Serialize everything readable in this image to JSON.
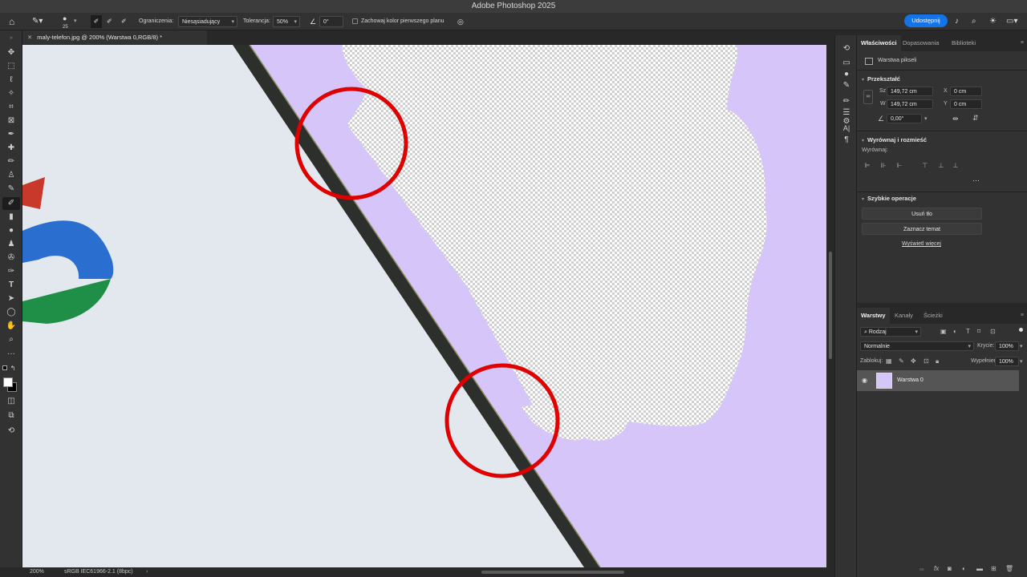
{
  "app": {
    "title": "Adobe Photoshop 2025"
  },
  "options": {
    "brush_size": "25",
    "constraints_label": "Ograniczenia:",
    "constraints_value": "Niesąsiadujący",
    "tolerance_label": "Tolerancja:",
    "tolerance_value": "50%",
    "angle_value": "0°",
    "protect_fg_label": "Zachowaj kolor pierwszego planu",
    "share_label": "Udostępnij"
  },
  "document": {
    "tab_title": "maly-telefon.jpg @ 200% (Warstwa 0,RGB/8) *"
  },
  "status": {
    "zoom": "200%",
    "profile": "sRGB IEC61966-2.1 (8bpc)"
  },
  "properties": {
    "tabs": [
      "Właściwości",
      "Dopasowania",
      "Biblioteki"
    ],
    "layer_kind": "Warstwa pikseli",
    "transform_title": "Przekształć",
    "w_label": "Sz",
    "w_value": "149,72 cm",
    "h_label": "W",
    "h_value": "149,72 cm",
    "x_label": "X",
    "x_value": "0 cm",
    "y_label": "Y",
    "y_value": "0 cm",
    "angle_value": "0,00°",
    "align_title": "Wyrównaj i rozmieść",
    "align_label": "Wyrównaj:",
    "quick_title": "Szybkie operacje",
    "remove_bg": "Usuń tło",
    "select_subject": "Zaznacz temat",
    "show_more": "Wyświetl więcej"
  },
  "layers": {
    "tabs": [
      "Warstwy",
      "Kanały",
      "Ścieżki"
    ],
    "filter_value": "Rodzaj",
    "blend_mode": "Normalnie",
    "opacity_label": "Krycie:",
    "opacity_value": "100%",
    "lock_label": "Zablokuj:",
    "fill_label": "Wypełnienie:",
    "fill_value": "100%",
    "layer_name": "Warstwa 0"
  },
  "colors": {
    "accent": "#1473e6",
    "annotation": "#e00000",
    "background_purple": "#d6c5f8"
  }
}
